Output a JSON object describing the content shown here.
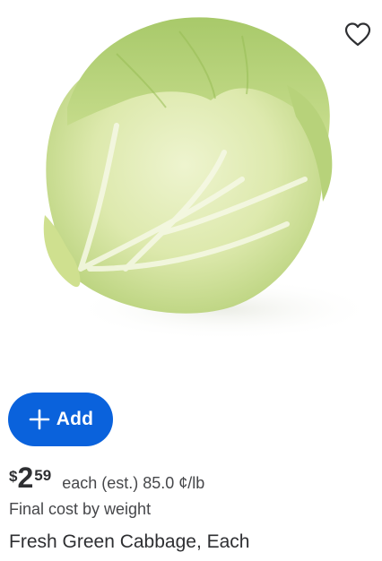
{
  "product": {
    "image_alt": "green cabbage head",
    "favorite_icon": "heart-outline-icon",
    "add_button": {
      "icon": "plus-icon",
      "label": "Add",
      "color": "#0a62dc"
    },
    "price": {
      "currency": "$",
      "dollars": "2",
      "cents": "59",
      "unit_text": "each (est.) 85.0 ¢/lb"
    },
    "final_cost_note": "Final cost by weight",
    "title": "Fresh Green Cabbage, Each"
  }
}
